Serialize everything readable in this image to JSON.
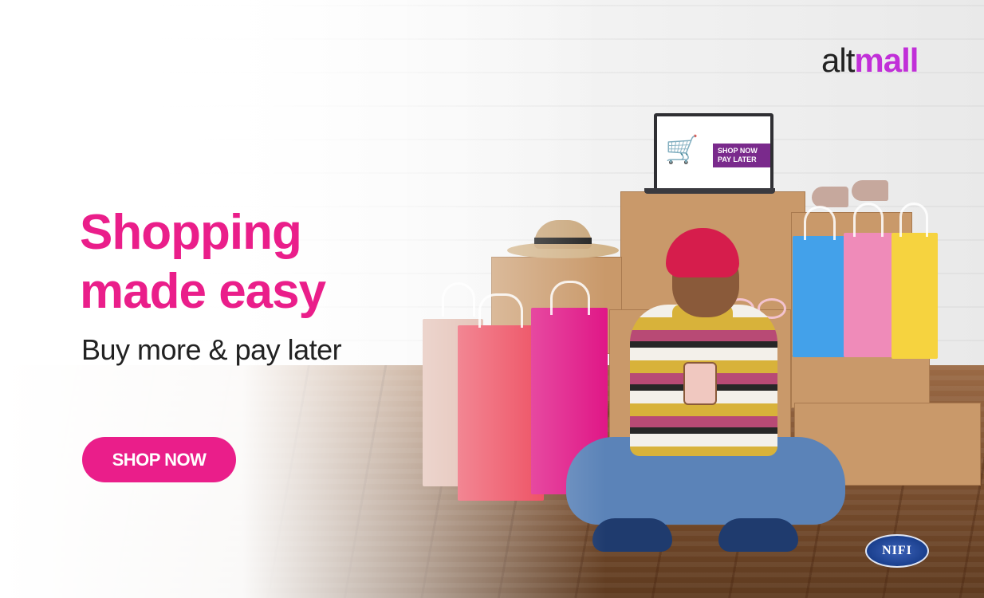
{
  "brand": {
    "logo_prefix": "alt",
    "logo_suffix": "mall",
    "accent_color": "#ea1e8a",
    "logo_color": "#c12fd8"
  },
  "hero": {
    "headline": "Shopping made easy",
    "subline": "Buy more & pay later",
    "cta_label": "SHOP NOW"
  },
  "laptop_screen": {
    "badge_label": "SHOP NOW PAY LATER"
  },
  "badge": {
    "label": "NIFI"
  }
}
